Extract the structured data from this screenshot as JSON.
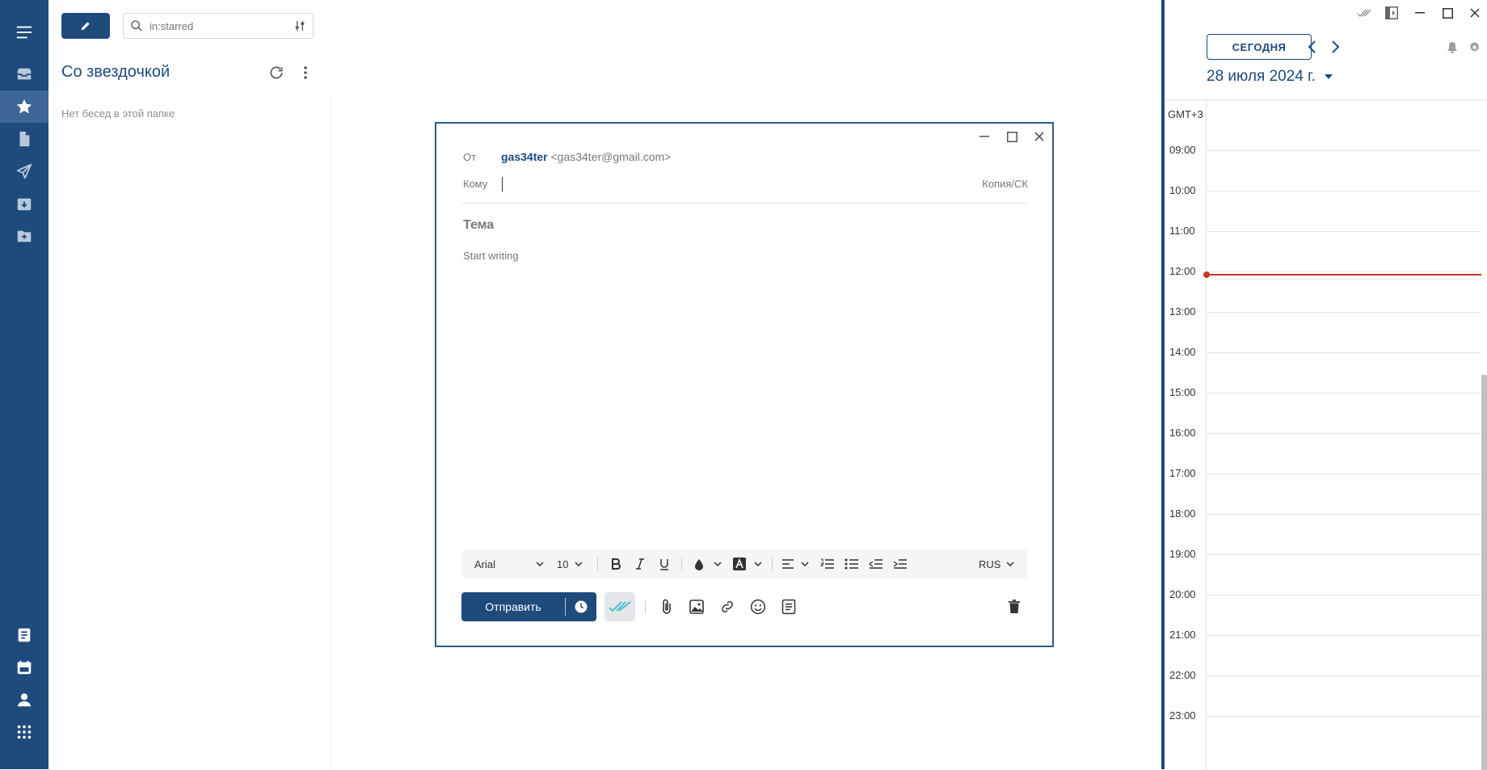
{
  "search": {
    "placeholder": "in:starred"
  },
  "folder": {
    "title": "Со звездочкой",
    "empty_text": "Нет бесед в этой папке"
  },
  "compose": {
    "from_label": "От",
    "from_name": "gas34ter",
    "from_email": "<gas34ter@gmail.com>",
    "to_label": "Кому",
    "cc_label": "Копия/СК",
    "subject_placeholder": "Тема",
    "body_placeholder": "Start writing",
    "font_family": "Arial",
    "font_size": "10",
    "language": "RUS",
    "send_label": "Отправить"
  },
  "calendar": {
    "today_button": "СЕГОДНЯ",
    "date_label": "28 июля 2024 г.",
    "timezone": "GMT+3",
    "hours": [
      "09:00",
      "10:00",
      "11:00",
      "12:00",
      "13:00",
      "14:00",
      "15:00",
      "16:00",
      "17:00",
      "18:00",
      "19:00",
      "20:00",
      "21:00",
      "22:00",
      "23:00"
    ],
    "current_time": "12:05"
  },
  "colors": {
    "brand": "#1e4a7c",
    "rail_active": "#3d6596",
    "now_line": "#c8342c",
    "ticks": "#3bbfc9"
  }
}
